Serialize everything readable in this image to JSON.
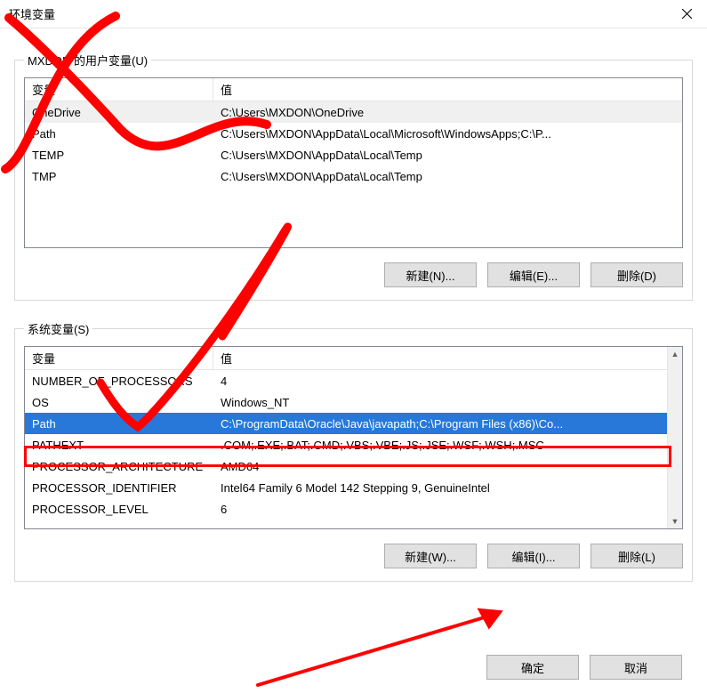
{
  "window": {
    "title": "环境变量"
  },
  "user_section": {
    "legend": "MXDON 的用户变量(U)",
    "col_name": "变量",
    "col_value": "值",
    "rows": [
      {
        "name": "OneDrive",
        "value": "C:\\Users\\MXDON\\OneDrive"
      },
      {
        "name": "Path",
        "value": "C:\\Users\\MXDON\\AppData\\Local\\Microsoft\\WindowsApps;C:\\P..."
      },
      {
        "name": "TEMP",
        "value": "C:\\Users\\MXDON\\AppData\\Local\\Temp"
      },
      {
        "name": "TMP",
        "value": "C:\\Users\\MXDON\\AppData\\Local\\Temp"
      }
    ],
    "btn_new": "新建(N)...",
    "btn_edit": "编辑(E)...",
    "btn_del": "删除(D)"
  },
  "system_section": {
    "legend": "系统变量(S)",
    "col_name": "变量",
    "col_value": "值",
    "rows": [
      {
        "name": "NUMBER_OF_PROCESSORS",
        "value": "4"
      },
      {
        "name": "OS",
        "value": "Windows_NT"
      },
      {
        "name": "Path",
        "value": "C:\\ProgramData\\Oracle\\Java\\javapath;C:\\Program Files (x86)\\Co..."
      },
      {
        "name": "PATHEXT",
        "value": ".COM;.EXE;.BAT;.CMD;.VBS;.VBE;.JS;.JSE;.WSF;.WSH;.MSC"
      },
      {
        "name": "PROCESSOR_ARCHITECTURE",
        "value": "AMD64"
      },
      {
        "name": "PROCESSOR_IDENTIFIER",
        "value": "Intel64 Family 6 Model 142 Stepping 9, GenuineIntel"
      },
      {
        "name": "PROCESSOR_LEVEL",
        "value": "6"
      }
    ],
    "selected_index": 2,
    "btn_new": "新建(W)...",
    "btn_edit": "编辑(I)...",
    "btn_del": "删除(L)"
  },
  "dialog_buttons": {
    "ok": "确定",
    "cancel": "取消"
  }
}
